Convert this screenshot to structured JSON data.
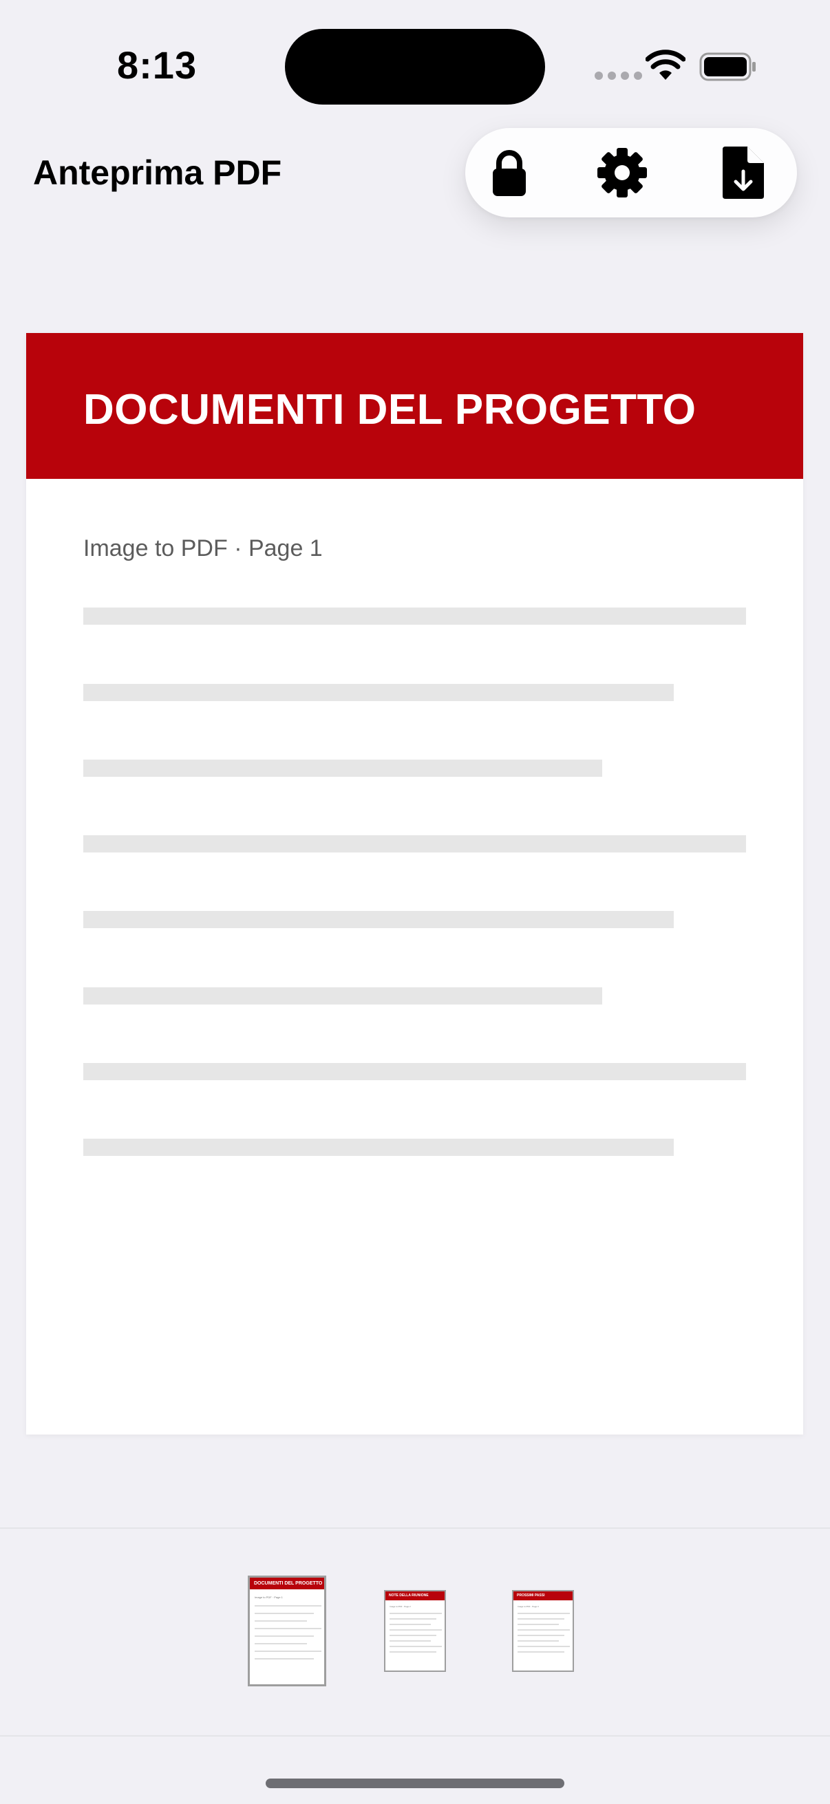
{
  "status_bar": {
    "time": "8:13",
    "icons": [
      "cellular-signal-icon",
      "wifi-icon",
      "battery-icon"
    ]
  },
  "header": {
    "title": "Anteprima PDF",
    "toolbar": {
      "buttons": [
        {
          "icon": "lock-icon"
        },
        {
          "icon": "gear-icon"
        },
        {
          "icon": "document-download-icon"
        }
      ]
    }
  },
  "preview": {
    "heading": "DOCUMENTI DEL PROGETTO",
    "subtitle": "Image to PDF · Page 1",
    "accent_color": "#B8030B"
  },
  "thumbnails": [
    {
      "heading": "DOCUMENTI DEL PROGETTO",
      "subtitle": "Image to PDF · Page 1",
      "selected": true
    },
    {
      "heading": "NOTE DELLA RIUNIONE",
      "subtitle": "Image to PDF · Page 2",
      "selected": false
    },
    {
      "heading": "PROSSIMI PASSI",
      "subtitle": "Image to PDF · Page 3",
      "selected": false
    }
  ]
}
